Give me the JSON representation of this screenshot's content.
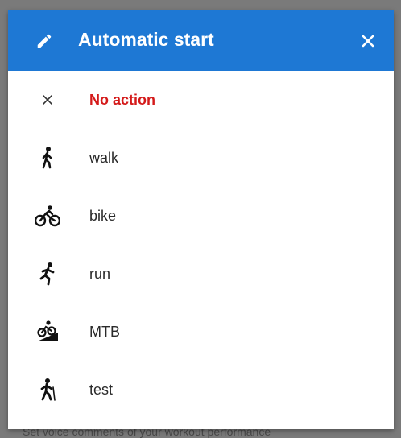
{
  "dialog": {
    "title": "Automatic start",
    "header_color": "#1e78d4",
    "icons": {
      "header_left": "pencil-icon",
      "header_right": "close-icon"
    }
  },
  "options": [
    {
      "label": "No action",
      "icon": "close-icon",
      "selected": true
    },
    {
      "label": "walk",
      "icon": "walk-icon",
      "selected": false
    },
    {
      "label": "bike",
      "icon": "bike-icon",
      "selected": false
    },
    {
      "label": "run",
      "icon": "run-icon",
      "selected": false
    },
    {
      "label": "MTB",
      "icon": "mtb-icon",
      "selected": false
    },
    {
      "label": "test",
      "icon": "hiking-icon",
      "selected": false
    }
  ],
  "colors": {
    "selected_text": "#d41a1a",
    "item_text": "#2a2a2a"
  }
}
